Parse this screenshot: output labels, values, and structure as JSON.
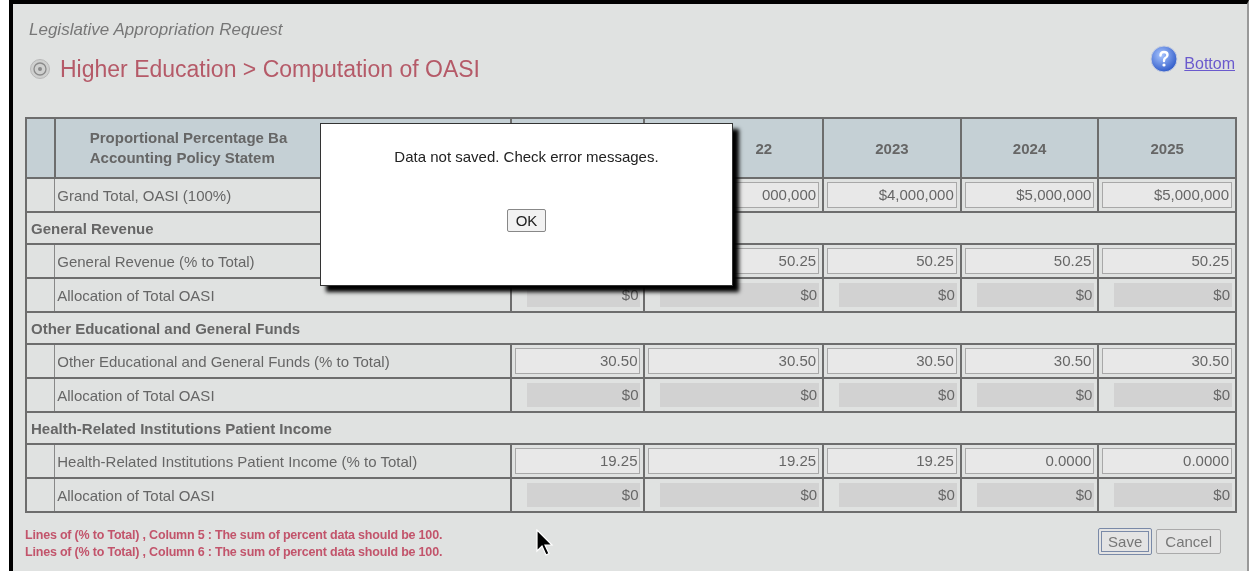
{
  "app_title": "Legislative Appropriation Request",
  "page_title": "Higher Education > Computation of OASI",
  "help_link": "Bottom",
  "table": {
    "columns": [
      {
        "lines": [
          "Proportional Percentage Ba",
          "Accounting Policy Statem"
        ]
      },
      {},
      {
        "lines": [
          "22"
        ]
      },
      {
        "lines": [
          "2023"
        ]
      },
      {
        "lines": [
          "2024"
        ]
      },
      {
        "lines": [
          "2025"
        ]
      }
    ],
    "rows": [
      {
        "kind": "input",
        "label": "Grand Total, OASI (100%)",
        "cells": [
          null,
          "000,000",
          "$4,000,000",
          "$5,000,000",
          "$5,000,000"
        ]
      },
      {
        "kind": "section",
        "label": "General Revenue"
      },
      {
        "kind": "input",
        "label": "General Revenue (% to Total)",
        "cells": [
          null,
          "50.25",
          "50.25",
          "50.25",
          "50.25"
        ]
      },
      {
        "kind": "computed",
        "label": "Allocation of Total OASI",
        "cells": [
          "$0",
          "$0",
          "$0",
          "$0",
          "$0"
        ]
      },
      {
        "kind": "section",
        "label": "Other Educational and General Funds"
      },
      {
        "kind": "input",
        "label": "Other Educational and General Funds (% to Total)",
        "cells": [
          "30.50",
          "30.50",
          "30.50",
          "30.50",
          "30.50"
        ]
      },
      {
        "kind": "computed",
        "label": "Allocation of Total OASI",
        "cells": [
          "$0",
          "$0",
          "$0",
          "$0",
          "$0"
        ]
      },
      {
        "kind": "section",
        "label": "Health-Related Institutions Patient Income"
      },
      {
        "kind": "input",
        "label": "Health-Related Institutions Patient Income (% to Total)",
        "cells": [
          "19.25",
          "19.25",
          "19.25",
          "0.0000",
          "0.0000"
        ]
      },
      {
        "kind": "computed",
        "label": "Allocation of Total OASI",
        "cells": [
          "$0",
          "$0",
          "$0",
          "$0",
          "$0"
        ]
      }
    ]
  },
  "errors": [
    "Lines of (% to Total) , Column 5 : The sum of percent data should be 100.",
    "Lines of (% to Total) , Column 6 : The sum of percent data should be 100."
  ],
  "buttons": [
    {
      "label": "Save",
      "focused": true
    },
    {
      "label": "Cancel",
      "focused": false
    }
  ],
  "dialog": {
    "message": "Data not saved. Check error messages.",
    "button": "OK"
  }
}
